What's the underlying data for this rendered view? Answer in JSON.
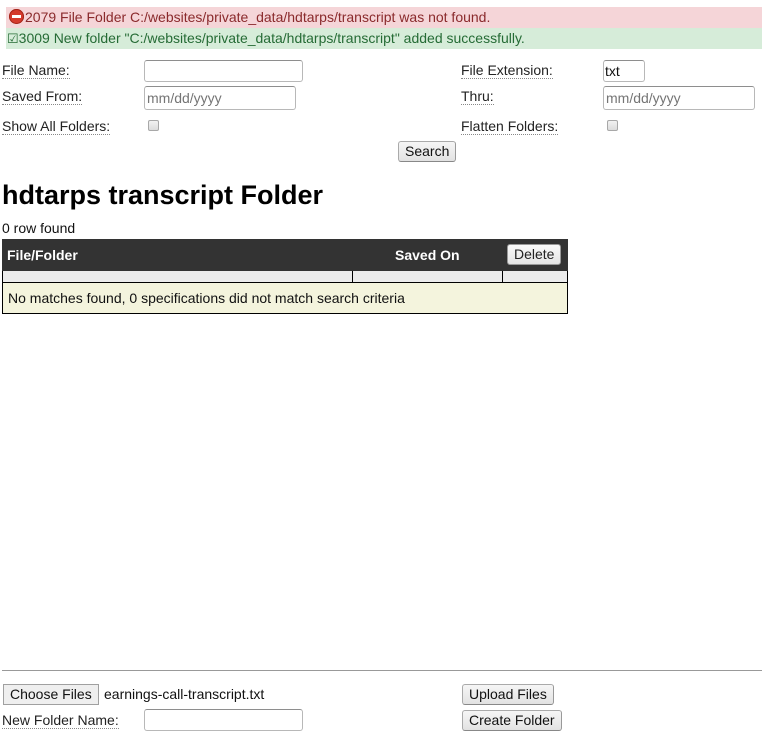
{
  "messages": {
    "error": {
      "icon": "no-entry-icon",
      "text": "2079 File Folder C:/websites/private_data/hdtarps/transcript was not found."
    },
    "success": {
      "icon": "ballot-box-with-check-icon",
      "icon_glyph": "☑",
      "text": "3009 New folder \"C:/websites/private_data/hdtarps/transcript\" added successfully."
    }
  },
  "search_form": {
    "file_name": {
      "label": "File Name:",
      "value": ""
    },
    "file_extension": {
      "label": "File Extension:",
      "value": "txt"
    },
    "saved_from": {
      "label": "Saved From:",
      "placeholder": "mm/dd/yyyy",
      "value": ""
    },
    "thru": {
      "label": "Thru:",
      "placeholder": "mm/dd/yyyy",
      "value": ""
    },
    "show_all_folders": {
      "label": "Show All Folders:",
      "checked": false
    },
    "flatten_folders": {
      "label": "Flatten Folders:",
      "checked": false
    },
    "search_button": "Search"
  },
  "page": {
    "title": "hdtarps transcript Folder",
    "row_count": "0 row found"
  },
  "table": {
    "columns": [
      "File/Folder",
      "Saved On"
    ],
    "delete_button": "Delete",
    "empty_message": "No matches found, 0 specifications did not match search criteria",
    "rows": []
  },
  "upload": {
    "choose_files_button": "Choose Files",
    "selected_file": "earnings-call-transcript.txt",
    "upload_button": "Upload Files",
    "new_folder_label": "New Folder Name:",
    "new_folder_value": "",
    "create_folder_button": "Create Folder"
  },
  "colors": {
    "error_bg": "#f5d5d8",
    "error_text": "#8a2a2c",
    "success_bg": "#d6ecd9",
    "success_text": "#256b35",
    "table_header_bg": "#333333",
    "empty_row_bg": "#f4f4dd"
  }
}
